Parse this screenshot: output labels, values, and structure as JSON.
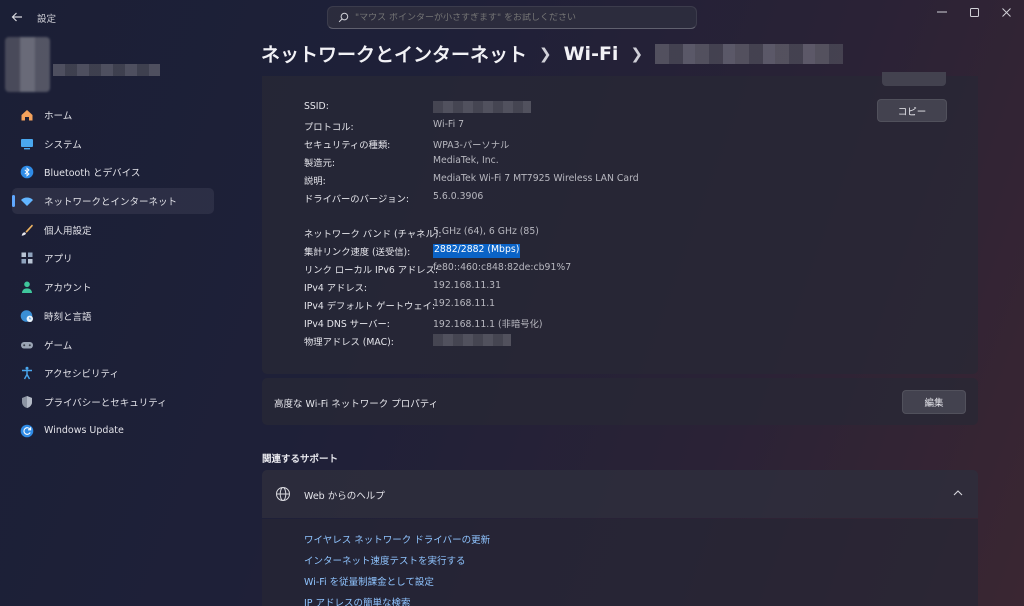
{
  "window": {
    "app_title": "設定",
    "search_placeholder": "\"マウス ポインターが小さすぎます\" をお試しください"
  },
  "sidebar": {
    "items": [
      {
        "label": "ホーム",
        "icon": "home-icon"
      },
      {
        "label": "システム",
        "icon": "monitor-icon"
      },
      {
        "label": "Bluetooth とデバイス",
        "icon": "bluetooth-icon"
      },
      {
        "label": "ネットワークとインターネット",
        "icon": "wifi-icon",
        "active": true
      },
      {
        "label": "個人用設定",
        "icon": "brush-icon"
      },
      {
        "label": "アプリ",
        "icon": "apps-icon"
      },
      {
        "label": "アカウント",
        "icon": "person-icon"
      },
      {
        "label": "時刻と言語",
        "icon": "globe-clock-icon"
      },
      {
        "label": "ゲーム",
        "icon": "gamepad-icon"
      },
      {
        "label": "アクセシビリティ",
        "icon": "accessibility-icon"
      },
      {
        "label": "プライバシーとセキュリティ",
        "icon": "shield-icon"
      },
      {
        "label": "Windows Update",
        "icon": "update-icon"
      }
    ]
  },
  "header": {
    "crumb1": "ネットワークとインターネット",
    "crumb2": "Wi-Fi"
  },
  "properties": {
    "copy_label": "コピー",
    "rows": [
      {
        "label": "SSID:",
        "value": ""
      },
      {
        "label": "プロトコル:",
        "value": "Wi-Fi 7"
      },
      {
        "label": "セキュリティの種類:",
        "value": "WPA3-パーソナル"
      },
      {
        "label": "製造元:",
        "value": "MediaTek, Inc."
      },
      {
        "label": "説明:",
        "value": "MediaTek Wi-Fi 7 MT7925 Wireless LAN Card"
      },
      {
        "label": "ドライバーのバージョン:",
        "value": "5.6.0.3906"
      },
      {
        "label": "ネットワーク バンド (チャネル):",
        "value": "5 GHz (64), 6 GHz (85)"
      },
      {
        "label": "集計リンク速度 (送受信):",
        "value": "2882/2882 (Mbps)"
      },
      {
        "label": "リンク ローカル IPv6 アドレス:",
        "value": "fe80::460:c848:82de:cb91%7"
      },
      {
        "label": "IPv4 アドレス:",
        "value": "192.168.11.31"
      },
      {
        "label": "IPv4 デフォルト ゲートウェイ:",
        "value": "192.168.11.1"
      },
      {
        "label": "IPv4 DNS サーバー:",
        "value": "192.168.11.1 (非暗号化)"
      },
      {
        "label": "物理アドレス (MAC):",
        "value": ""
      }
    ]
  },
  "advanced": {
    "label": "高度な Wi-Fi ネットワーク プロパティ",
    "edit_label": "編集"
  },
  "support": {
    "section_title": "関連するサポート",
    "help_label": "Web からのヘルプ",
    "links": [
      "ワイヤレス ネットワーク ドライバーの更新",
      "インターネット速度テストを実行する",
      "Wi-Fi を従量制課金として設定",
      "IP アドレスの簡単な検索"
    ]
  },
  "colors": {
    "accent": "#60a8ff",
    "link": "#8fc4ff",
    "selection": "#0a63c6"
  }
}
